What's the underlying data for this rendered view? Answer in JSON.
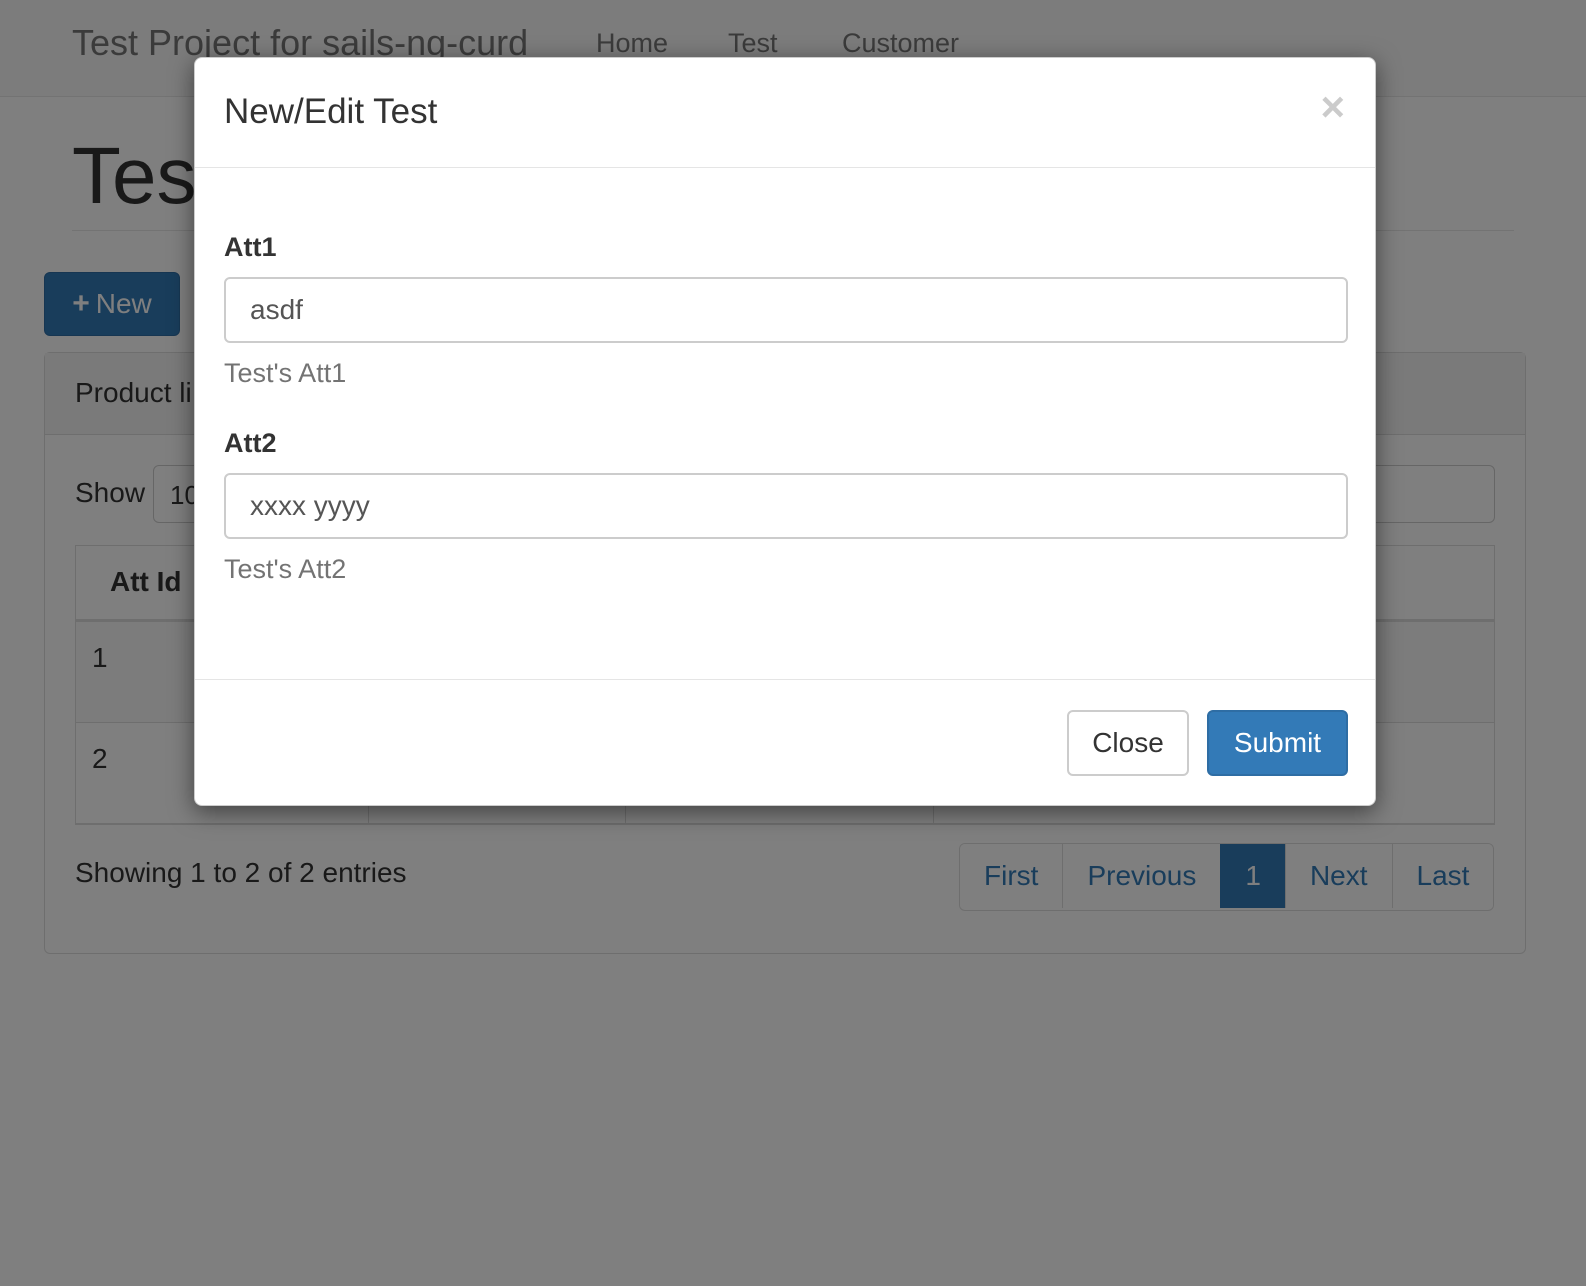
{
  "navbar": {
    "brand": "Test Project for sails-ng-curd",
    "items": [
      {
        "label": "Home"
      },
      {
        "label": "Test"
      },
      {
        "label": "Customer"
      }
    ]
  },
  "page": {
    "title": "Test",
    "new_button": {
      "icon": "plus-icon",
      "label": "New"
    }
  },
  "panel": {
    "title": "Product li",
    "show_label": "Show",
    "show_value": "10",
    "table": {
      "headers": [
        "Att Id"
      ],
      "rows": [
        {
          "id": "1"
        },
        {
          "id": "2"
        }
      ]
    },
    "info": "Showing 1 to 2 of 2 entries",
    "pagination": {
      "first": "First",
      "previous": "Previous",
      "current": "1",
      "next": "Next",
      "last": "Last"
    }
  },
  "modal": {
    "title": "New/Edit Test",
    "close_symbol": "×",
    "fields": [
      {
        "label": "Att1",
        "value": "asdf",
        "help": "Test's Att1"
      },
      {
        "label": "Att2",
        "value": "xxxx yyyy",
        "help": "Test's Att2"
      }
    ],
    "close_button": "Close",
    "submit_button": "Submit"
  },
  "colors": {
    "primary": "#337ab7",
    "backdrop": "#000000"
  }
}
